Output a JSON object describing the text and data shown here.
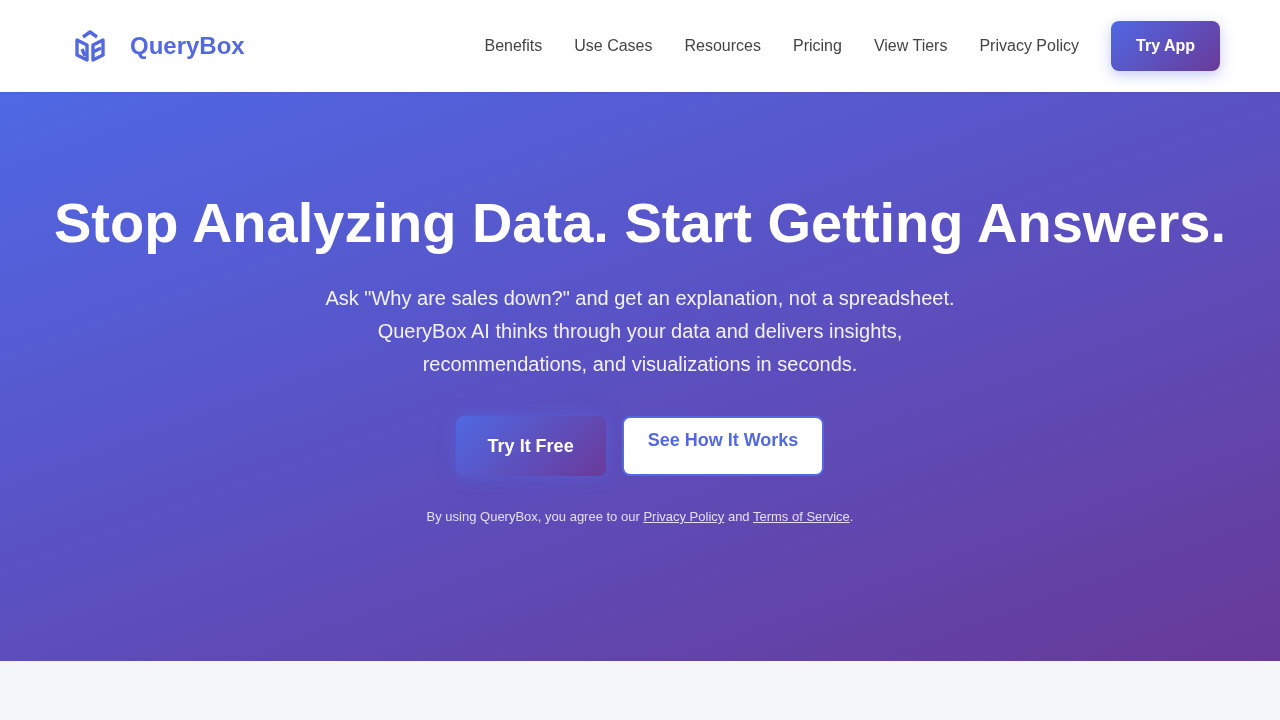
{
  "header": {
    "brand": "QueryBox",
    "nav": [
      "Benefits",
      "Use Cases",
      "Resources",
      "Pricing",
      "View Tiers",
      "Privacy Policy"
    ],
    "cta": "Try App"
  },
  "hero": {
    "title": "Stop Analyzing Data. Start Getting Answers.",
    "subtitle": "Ask \"Why are sales down?\" and get an explanation, not a spreadsheet. QueryBox AI thinks through your data and delivers insights, recommendations, and visualizations in seconds.",
    "buttons": [
      {
        "label": "Try It Free",
        "kind": "primary"
      },
      {
        "label": "See How It Works",
        "kind": "secondary"
      }
    ],
    "legal": [
      {
        "kind": "text",
        "text": "By using QueryBox, you agree to our "
      },
      {
        "kind": "link",
        "text": "Privacy Policy"
      },
      {
        "kind": "text",
        "text": " and "
      },
      {
        "kind": "link",
        "text": "Terms of Service"
      },
      {
        "kind": "text",
        "text": "."
      }
    ]
  }
}
